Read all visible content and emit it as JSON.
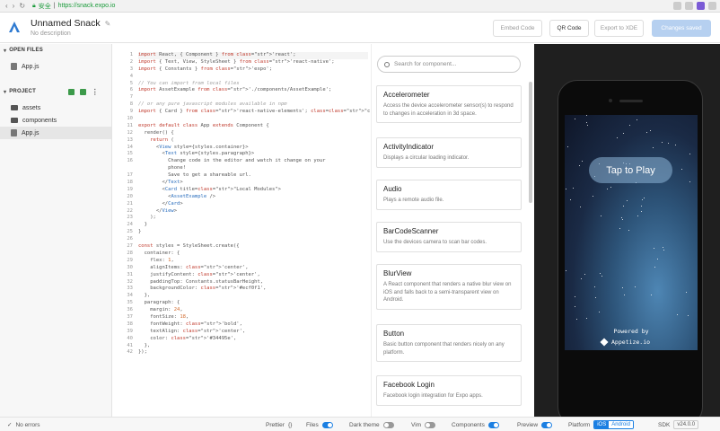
{
  "browser": {
    "secure_label": "安全",
    "url": "https://snack.expo.io"
  },
  "header": {
    "title": "Unnamed Snack",
    "subtitle": "No description",
    "embed_label": "Embed Code",
    "qr_label": "QR Code",
    "export_label": "Export to XDE",
    "save_label": "Changes saved"
  },
  "sidebar": {
    "open_files_title": "OPEN FILES",
    "open_files": [
      "App.js"
    ],
    "project_title": "PROJECT",
    "project_items": [
      {
        "label": "assets",
        "type": "folder"
      },
      {
        "label": "components",
        "type": "folder"
      },
      {
        "label": "App.js",
        "type": "file"
      }
    ]
  },
  "editor": {
    "lines": [
      "import React, { Component } from 'react';",
      "import { Text, View, StyleSheet } from 'react-native';",
      "import { Constants } from 'expo';",
      "",
      "// You can import from local files",
      "import AssetExample from './components/AssetExample';",
      "",
      "// or any pure javascript modules available in npm",
      "import { Card } from 'react-native-elements'; // 0.18.5",
      "",
      "export default class App extends Component {",
      "  render() {",
      "    return (",
      "      <View style={styles.container}>",
      "        <Text style={styles.paragraph}>",
      "          Change code in the editor and watch it change on your",
      "          phone!",
      "          Save to get a shareable url.",
      "        </Text>",
      "        <Card title=\"Local Modules\">",
      "          <AssetExample />",
      "        </Card>",
      "      </View>",
      "    );",
      "  }",
      "}",
      "",
      "const styles = StyleSheet.create({",
      "  container: {",
      "    flex: 1,",
      "    alignItems: 'center',",
      "    justifyContent: 'center',",
      "    paddingTop: Constants.statusBarHeight,",
      "    backgroundColor: '#ecf0f1',",
      "  },",
      "  paragraph: {",
      "    margin: 24,",
      "    fontSize: 18,",
      "    fontWeight: 'bold',",
      "    textAlign: 'center',",
      "    color: '#34495e',",
      "  },",
      "});"
    ],
    "gutter": [
      "1",
      "2",
      "3",
      "4",
      "5",
      "6",
      "7",
      "8",
      "9",
      "10",
      "11",
      "12",
      "13",
      "14",
      "15",
      "16",
      "",
      "17",
      "18",
      "19",
      "20",
      "21",
      "22",
      "23",
      "24",
      "25",
      "26",
      "27",
      "28",
      "29",
      "30",
      "31",
      "32",
      "33",
      "34",
      "35",
      "36",
      "37",
      "38",
      "39",
      "40",
      "41",
      "42",
      "43"
    ]
  },
  "components_panel": {
    "search_placeholder": "Search for component...",
    "items": [
      {
        "name": "Accelerometer",
        "desc": "Access the device accelerometer sensor(s) to respond to changes in acceleration in 3d space."
      },
      {
        "name": "ActivityIndicator",
        "desc": "Displays a circular loading indicator."
      },
      {
        "name": "Audio",
        "desc": "Plays a remote audio file."
      },
      {
        "name": "BarCodeScanner",
        "desc": "Use the devices camera to scan bar codes."
      },
      {
        "name": "BlurView",
        "desc": "A React component that renders a native blur view on iOS and falls back to a semi-transparent view on Android."
      },
      {
        "name": "Button",
        "desc": "Basic button component that renders nicely on any platform."
      },
      {
        "name": "Facebook Login",
        "desc": "Facebook login integration for Expo apps."
      }
    ]
  },
  "preview": {
    "tap_label": "Tap to Play",
    "powered_by": "Powered by",
    "appetize": "Appetize.io"
  },
  "footer": {
    "errors": "No errors",
    "prettier": "Prettier",
    "files": "Files",
    "dark_theme": "Dark theme",
    "vim": "Vim",
    "components": "Components",
    "preview": "Preview",
    "platform": "Platform",
    "ios": "iOS",
    "android": "Android",
    "sdk": "SDK",
    "sdk_version": "v24.0.0"
  },
  "colors": {
    "accent": "#1b7fe2",
    "save_button": "#b6d0f0",
    "preview_bg": "#1f1f1f"
  }
}
